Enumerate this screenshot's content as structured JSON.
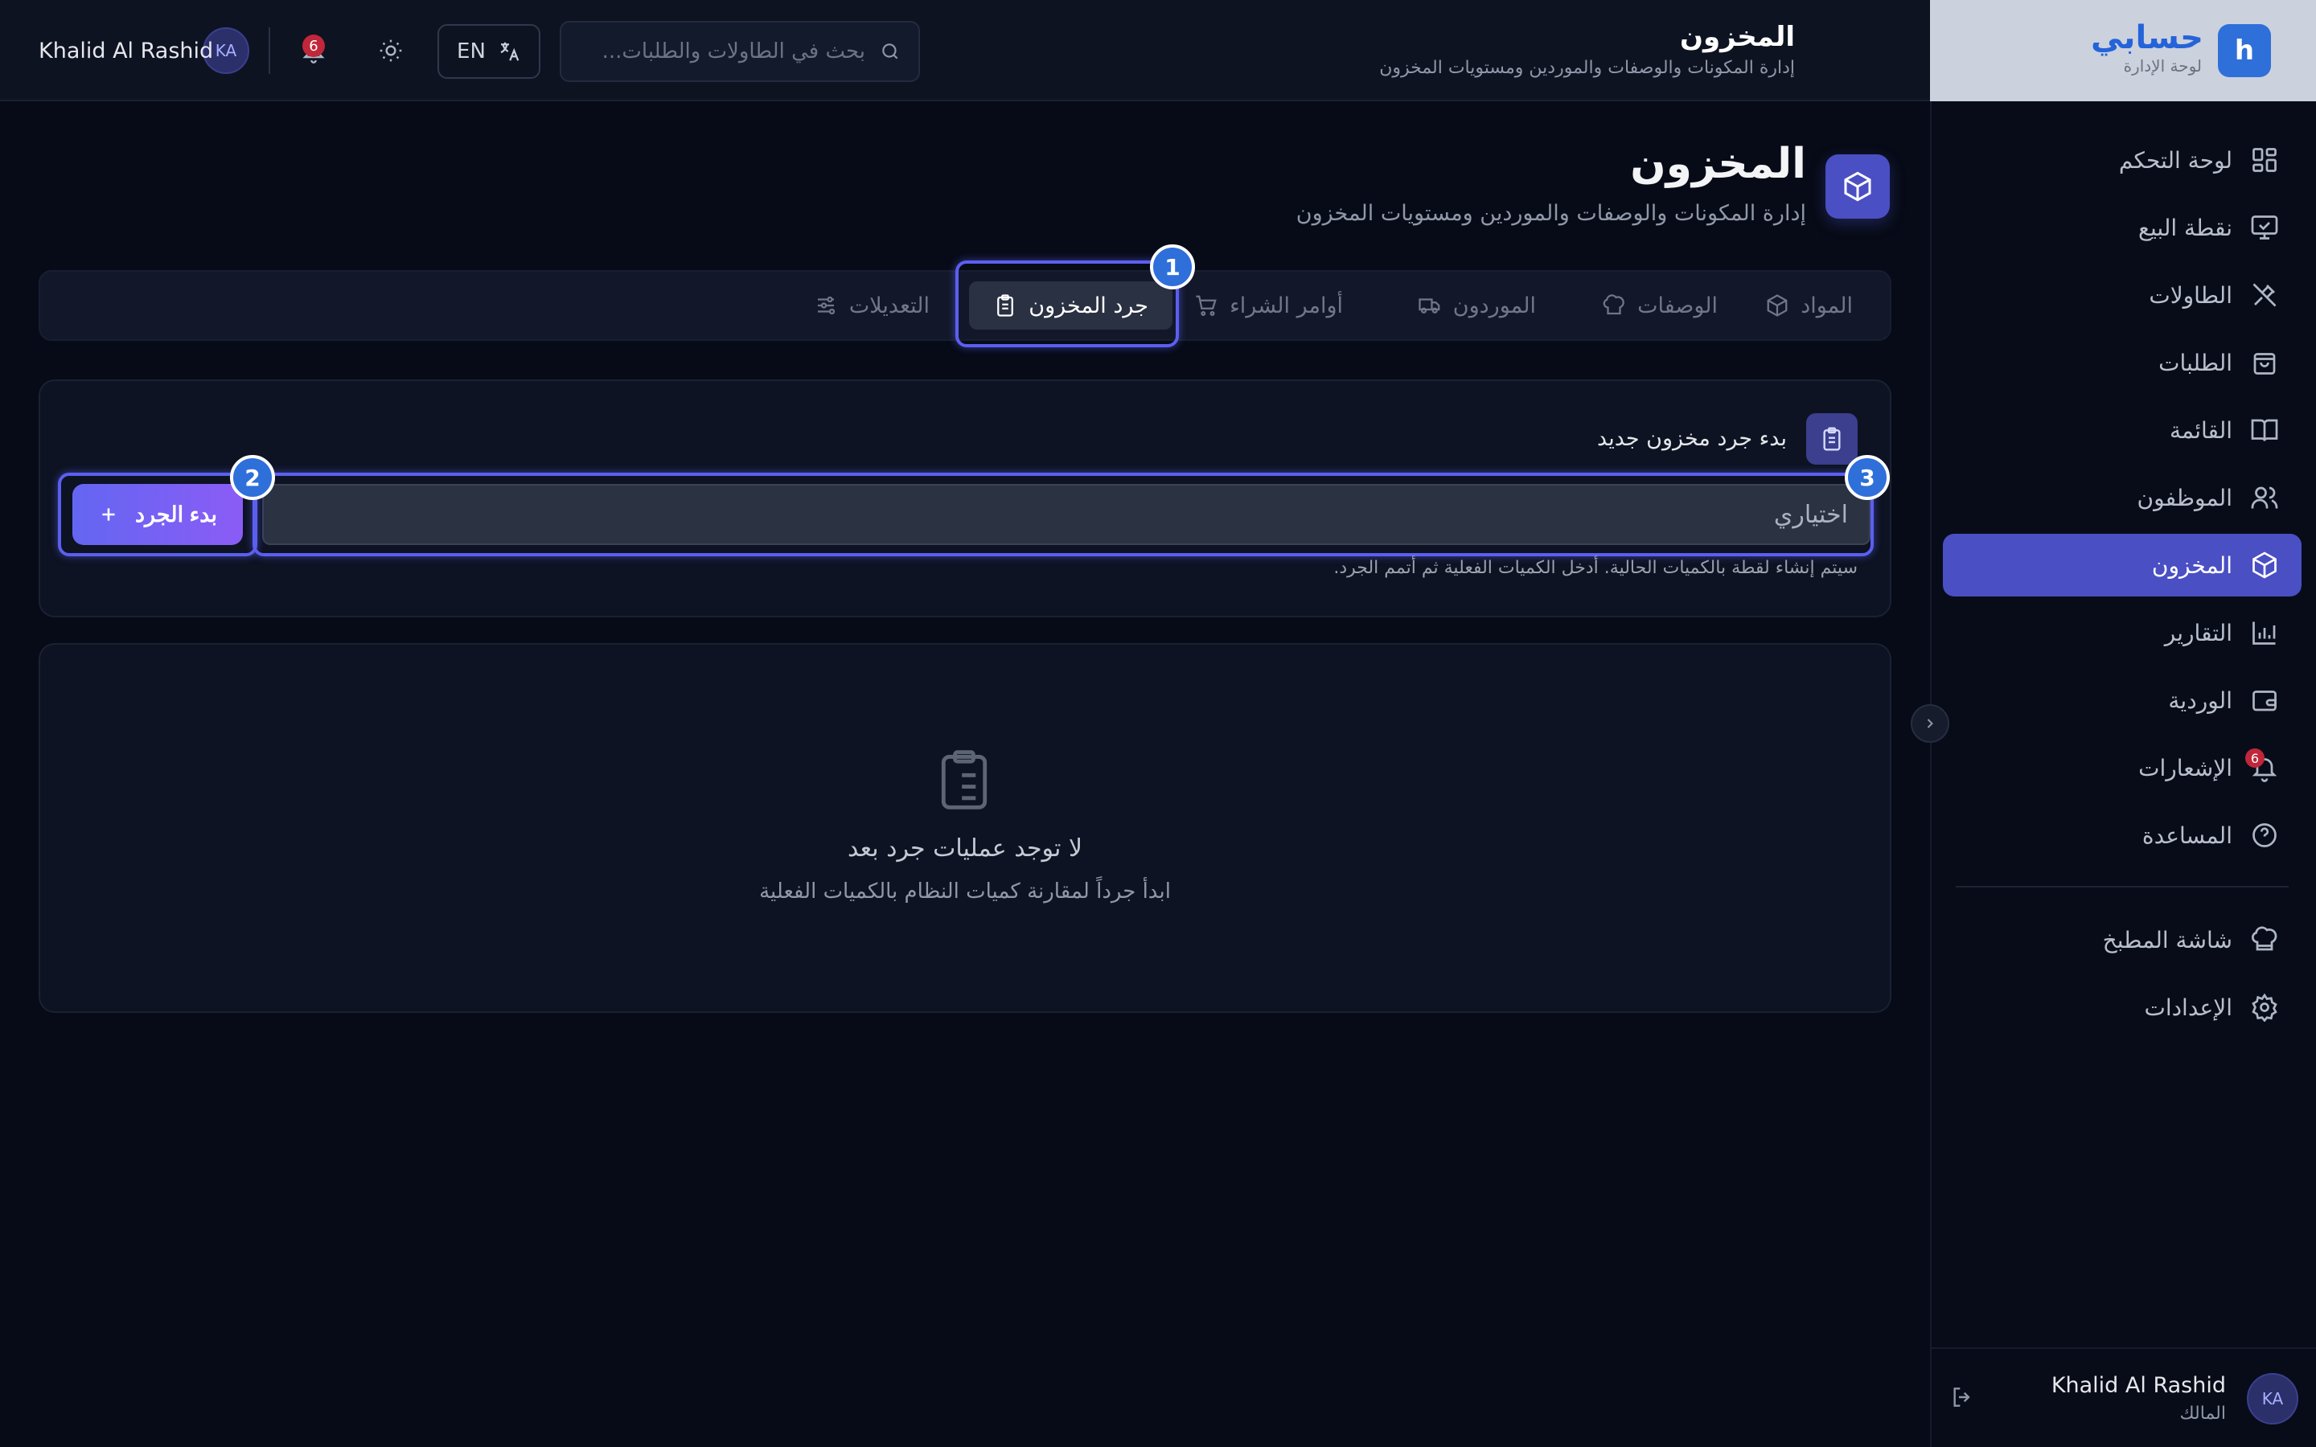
{
  "brand": {
    "name": "حسابي",
    "subtitle": "لوحة الإدارة",
    "logo_letter": "h"
  },
  "header": {
    "title": "المخزون",
    "subtitle": "إدارة المكونات والوصفات والموردين ومستويات المخزون",
    "search_placeholder": "بحث في الطاولات والطلبات...",
    "language_label": "EN",
    "notifications_count": "6",
    "user_name": "Khalid Al Rashid",
    "user_initials": "KA"
  },
  "sidebar": {
    "items": [
      {
        "label": "لوحة التحكم",
        "icon": "dashboard-icon"
      },
      {
        "label": "نقطة البيع",
        "icon": "pos-monitor-icon"
      },
      {
        "label": "الطاولات",
        "icon": "utensils-icon"
      },
      {
        "label": "الطلبات",
        "icon": "shopping-bag-icon"
      },
      {
        "label": "القائمة",
        "icon": "book-open-icon"
      },
      {
        "label": "الموظفون",
        "icon": "users-icon"
      },
      {
        "label": "المخزون",
        "icon": "package-icon",
        "active": true
      },
      {
        "label": "التقارير",
        "icon": "bar-chart-icon"
      },
      {
        "label": "الوردية",
        "icon": "wallet-icon"
      },
      {
        "label": "الإشعارات",
        "icon": "bell-icon",
        "badge": "6"
      },
      {
        "label": "المساعدة",
        "icon": "help-circle-icon"
      }
    ],
    "secondary": [
      {
        "label": "شاشة المطبخ",
        "icon": "chef-hat-icon"
      },
      {
        "label": "الإعدادات",
        "icon": "settings-icon"
      }
    ],
    "user": {
      "name": "Khalid Al Rashid",
      "role": "المالك",
      "initials": "KA"
    }
  },
  "page": {
    "title": "المخزون",
    "subtitle": "إدارة المكونات والوصفات والموردين ومستويات المخزون"
  },
  "tabs": [
    {
      "label": "المواد",
      "icon": "package-icon"
    },
    {
      "label": "الوصفات",
      "icon": "chef-hat-icon"
    },
    {
      "label": "الموردون",
      "icon": "truck-icon"
    },
    {
      "label": "أوامر الشراء",
      "icon": "cart-icon"
    },
    {
      "label": "جرد المخزون",
      "icon": "clipboard-icon",
      "active": true
    },
    {
      "label": "التعديلات",
      "icon": "sliders-icon"
    }
  ],
  "stocktake": {
    "card_title": "بدء جرد مخزون جديد",
    "notes_placeholder": "اختياري",
    "start_button": "بدء الجرد",
    "hint": "سيتم إنشاء لقطة بالكميات الحالية. أدخل الكميات الفعلية ثم أتمم الجرد."
  },
  "empty_state": {
    "title": "لا توجد عمليات جرد بعد",
    "subtitle": "ابدأ جرداً لمقارنة كميات النظام بالكميات الفعلية"
  },
  "highlights": [
    "1",
    "2",
    "3"
  ],
  "colors": {
    "accent": "#4a4fc4",
    "highlight": "#5b5ff0",
    "badge": "#c0273a",
    "background": "#070b17"
  }
}
